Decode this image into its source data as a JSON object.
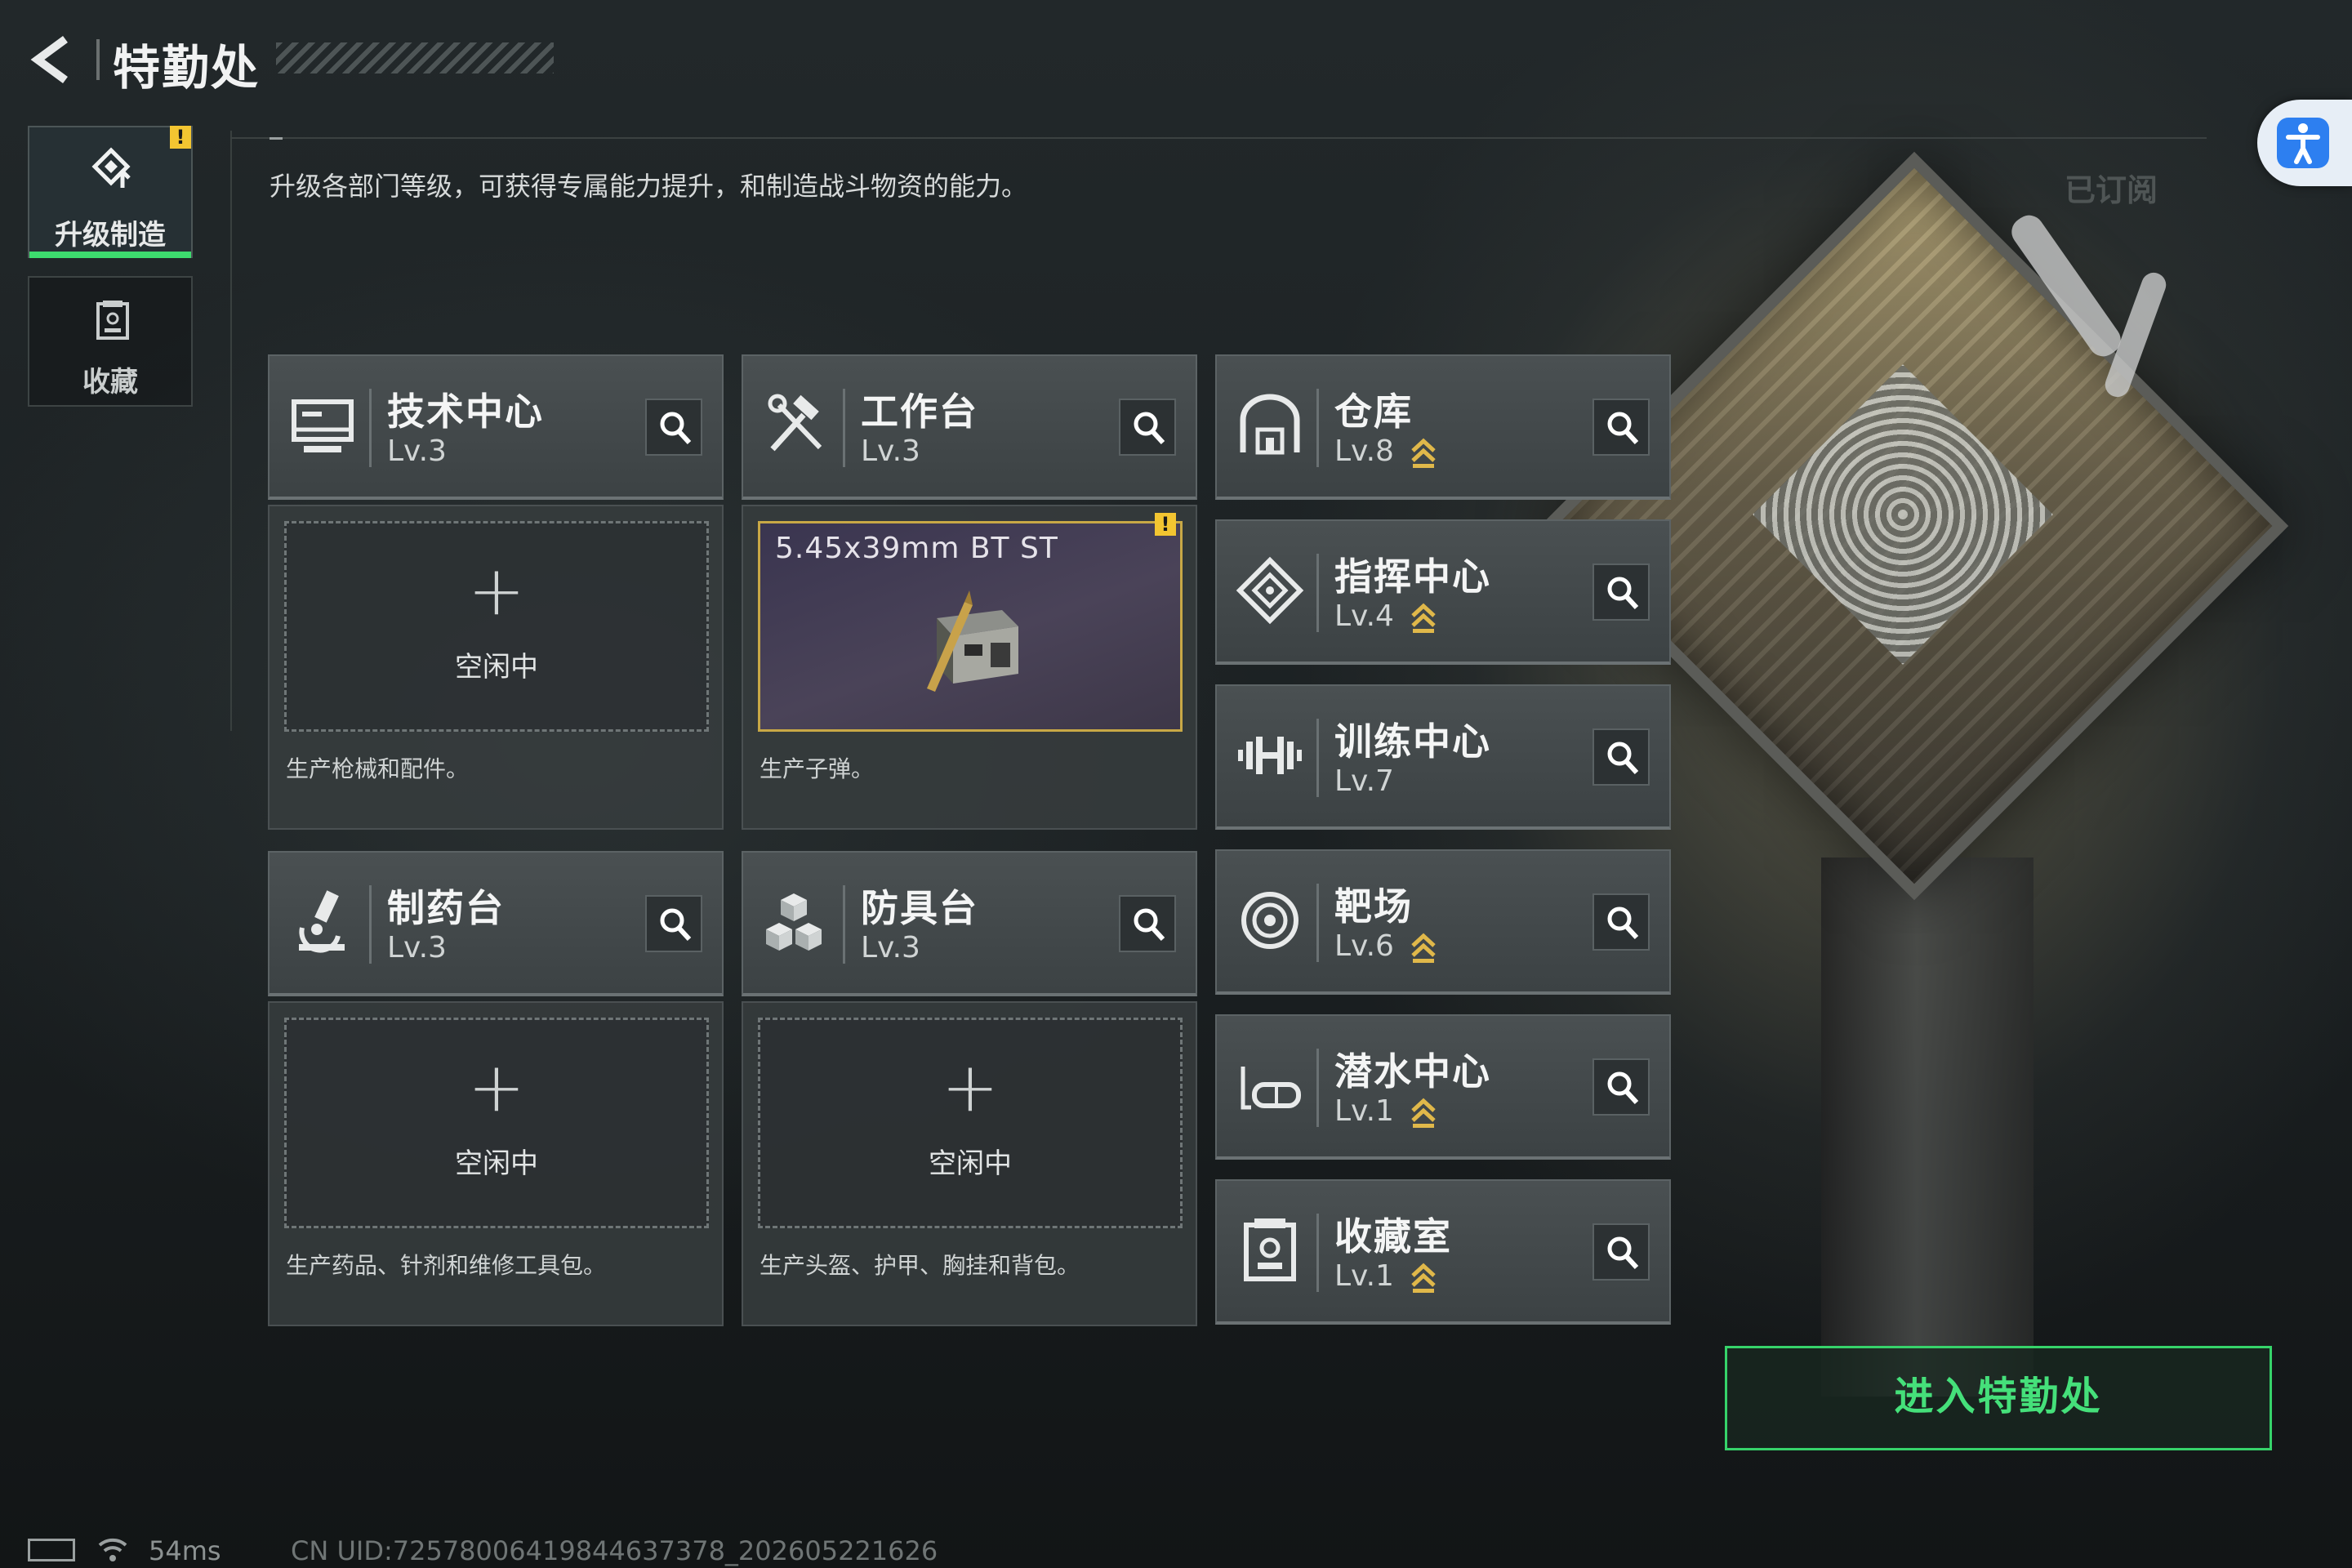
{
  "header": {
    "title": "特勤处"
  },
  "sidebar": {
    "tabs": [
      {
        "label": "升级制造",
        "active": true,
        "alert": "!"
      },
      {
        "label": "收藏",
        "active": false
      }
    ]
  },
  "description": "升级各部门等级，可获得专属能力提升，和制造战斗物资的能力。",
  "subscribed_label": "已订阅",
  "left_cards": [
    {
      "name": "技术中心",
      "level": "Lv.3",
      "icon": "monitor-icon",
      "slot": {
        "plus": "+",
        "status": "空闲中"
      },
      "desc": "生产枪械和配件。"
    },
    {
      "name": "工作台",
      "level": "Lv.3",
      "icon": "hammer-wrench-icon",
      "slot": {
        "product": "5.45x39mm BT ST",
        "alert": "!"
      },
      "desc": "生产子弹。"
    },
    {
      "name": "制药台",
      "level": "Lv.3",
      "icon": "microscope-icon",
      "slot": {
        "plus": "+",
        "status": "空闲中"
      },
      "desc": "生产药品、针剂和维修工具包。"
    },
    {
      "name": "防具台",
      "level": "Lv.3",
      "icon": "blocks-icon",
      "slot": {
        "plus": "+",
        "status": "空闲中"
      },
      "desc": "生产头盔、护甲、胸挂和背包。"
    }
  ],
  "right_cards": [
    {
      "name": "仓库",
      "level": "Lv.8",
      "icon": "warehouse-icon",
      "upgradable": true
    },
    {
      "name": "指挥中心",
      "level": "Lv.4",
      "icon": "command-diamond-icon",
      "upgradable": true
    },
    {
      "name": "训练中心",
      "level": "Lv.7",
      "icon": "dumbbell-icon",
      "upgradable": false
    },
    {
      "name": "靶场",
      "level": "Lv.6",
      "icon": "target-icon",
      "upgradable": true
    },
    {
      "name": "潜水中心",
      "level": "Lv.1",
      "icon": "diving-mask-icon",
      "upgradable": true
    },
    {
      "name": "收藏室",
      "level": "Lv.1",
      "icon": "collection-case-icon",
      "upgradable": true
    }
  ],
  "enter_button": "进入特勤处",
  "status": {
    "ping": "54ms",
    "uid": "CN UID:7257800641984463737​8_202605221626"
  },
  "colors": {
    "accent_green": "#3ddc6e",
    "alert_yellow": "#f3c531",
    "upgrade_gold": "#e0b84a",
    "product_border": "#c8a846"
  }
}
